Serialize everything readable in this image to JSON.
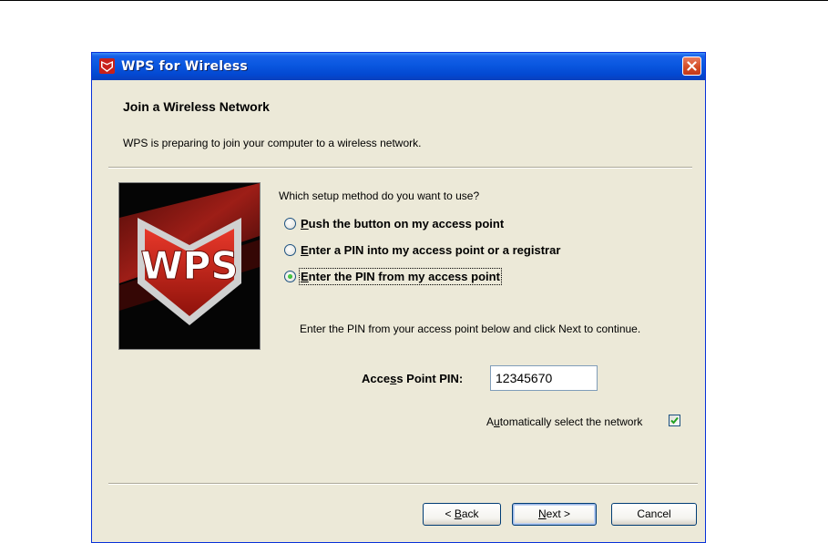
{
  "window": {
    "title": "WPS for Wireless",
    "close_icon": "close-icon"
  },
  "header": {
    "title": "Join a Wireless Network",
    "subtitle": "WPS is preparing to join your computer to a wireless network."
  },
  "logo": {
    "text": "WPS",
    "accent_color": "#d42a1f"
  },
  "setup": {
    "prompt": "Which setup method do you want to use?",
    "options": [
      {
        "label_pre": "",
        "label_ul": "P",
        "label_post": "ush the button on my access point",
        "selected": false
      },
      {
        "label_pre": "",
        "label_ul": "E",
        "label_post": "nter a PIN into my access point or a registrar",
        "selected": false
      },
      {
        "label_pre": "",
        "label_ul": "E",
        "label_post": "nter the PIN from my access point",
        "selected": true
      }
    ],
    "instruction": "Enter the PIN from your access point below and click Next to continue.",
    "pin_label_pre": "Acce",
    "pin_label_ul": "s",
    "pin_label_post": "s Point PIN:",
    "pin_value": "12345670",
    "auto_select_pre": "A",
    "auto_select_ul": "u",
    "auto_select_post": "tomatically select the network",
    "auto_select_checked": true
  },
  "buttons": {
    "back_pre": "< ",
    "back_ul": "B",
    "back_post": "ack",
    "next_ul": "N",
    "next_post": "ext >",
    "cancel": "Cancel"
  }
}
